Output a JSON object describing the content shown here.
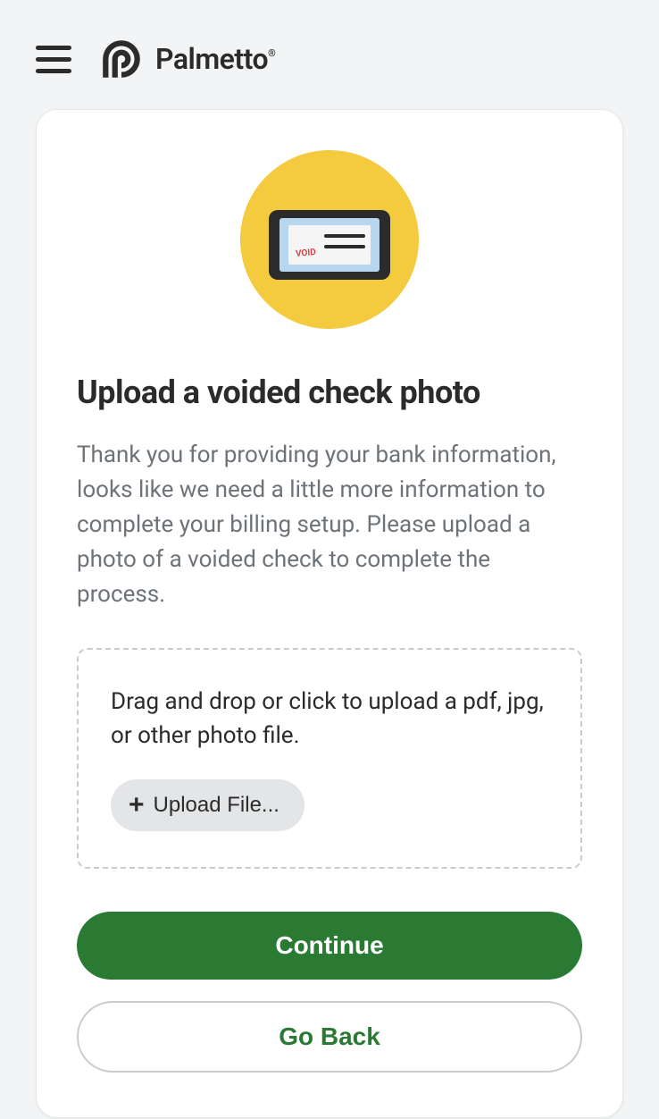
{
  "header": {
    "brand_name": "Palmetto"
  },
  "card": {
    "heading": "Upload a voided check photo",
    "description": "Thank you for providing your bank information, looks like we need a little more information to complete your billing setup. Please upload a photo of a voided check to complete the process.",
    "dropzone": {
      "instruction": "Drag and drop or click to upload a pdf, jpg, or other photo file.",
      "upload_button_label": "Upload File..."
    },
    "buttons": {
      "continue": "Continue",
      "go_back": "Go Back"
    },
    "illustration": {
      "void_label": "VOID"
    }
  }
}
